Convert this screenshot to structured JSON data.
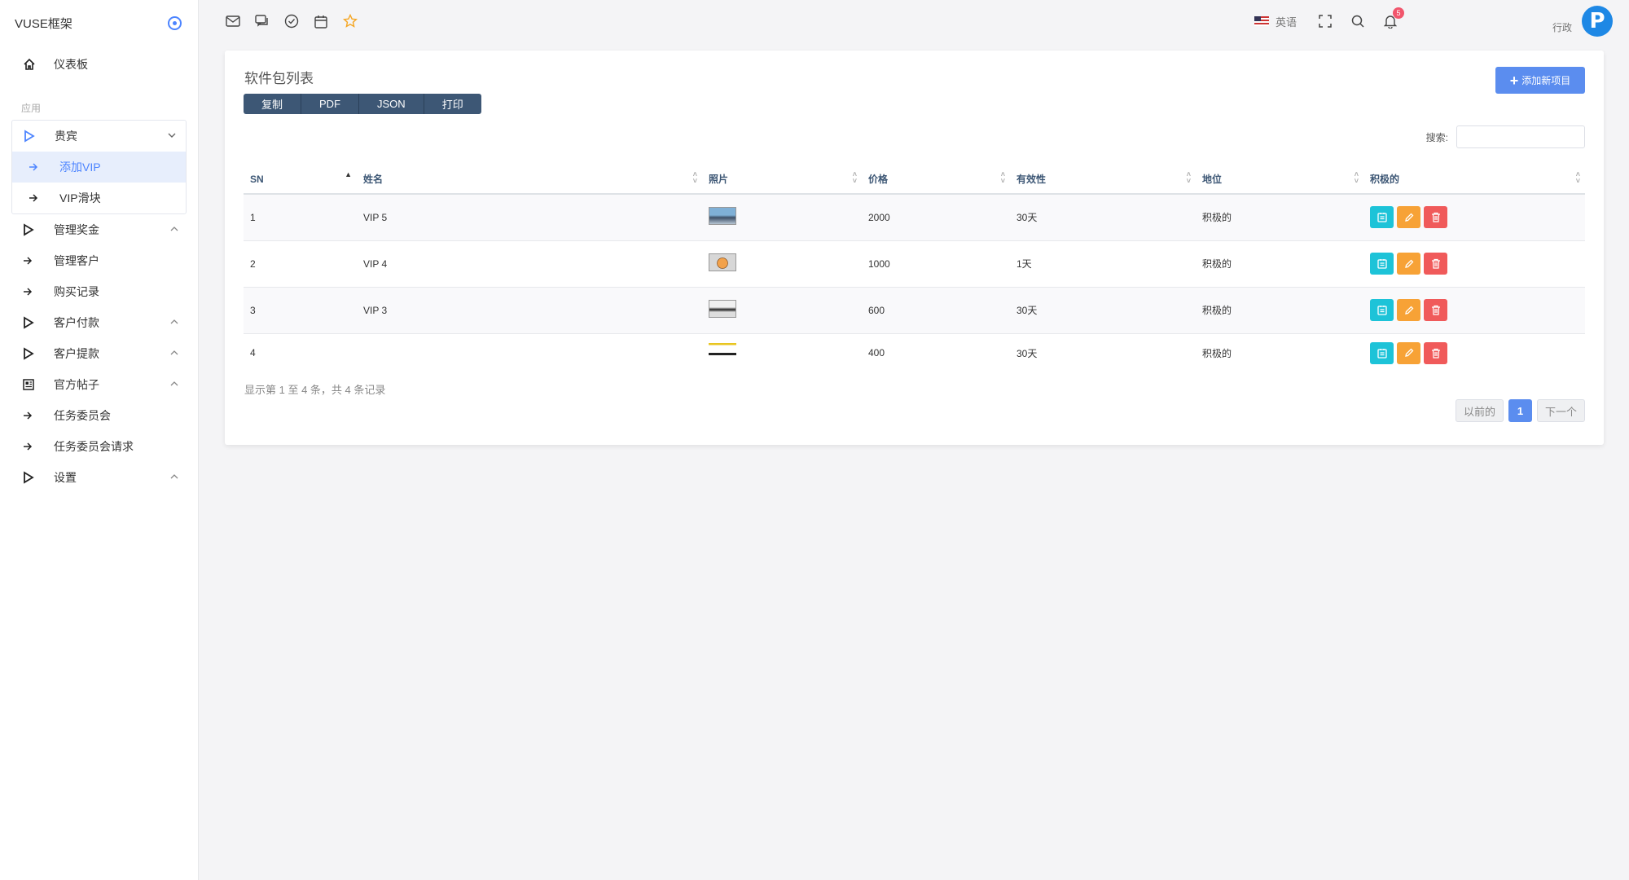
{
  "brand": "VUSE框架",
  "sidebar": {
    "dashboard": "仪表板",
    "section_label": "应用",
    "vip_group": {
      "label": "贵宾",
      "items": [
        {
          "label": "添加VIP",
          "active": true
        },
        {
          "label": "VIP滑块",
          "active": false
        }
      ]
    },
    "items": [
      {
        "label": "管理奖金",
        "icon": "play-outline-icon",
        "chevron": "˄"
      },
      {
        "label": "管理客户",
        "icon": "arrow-right-icon"
      },
      {
        "label": "购买记录",
        "icon": "arrow-right-icon"
      },
      {
        "label": "客户付款",
        "icon": "play-outline-icon",
        "chevron": "˄"
      },
      {
        "label": "客户提款",
        "icon": "play-outline-icon",
        "chevron": "˄"
      },
      {
        "label": "官方帖子",
        "icon": "newspaper-icon",
        "chevron": "˄"
      },
      {
        "label": "任务委员会",
        "icon": "arrow-right-icon"
      },
      {
        "label": "任务委员会请求",
        "icon": "arrow-right-icon"
      },
      {
        "label": "设置",
        "icon": "play-outline-icon",
        "chevron": "˄"
      }
    ]
  },
  "topbar": {
    "language": "英语",
    "notification_count": "5",
    "role": "行政",
    "avatar_letter": "P"
  },
  "card": {
    "title": "软件包列表",
    "export_buttons": [
      "复制",
      "PDF",
      "JSON",
      "打印"
    ],
    "add_button": "添加新项目",
    "search_label": "搜索:",
    "search_value": ""
  },
  "table": {
    "headers": [
      "SN",
      "姓名",
      "照片",
      "价格",
      "有效性",
      "地位",
      "积极的"
    ],
    "rows": [
      {
        "sn": "1",
        "name": "VIP 5",
        "price": "2000",
        "validity": "30天",
        "status": "积极的"
      },
      {
        "sn": "2",
        "name": "VIP 4",
        "price": "1000",
        "validity": "1天",
        "status": "积极的"
      },
      {
        "sn": "3",
        "name": "VIP 3",
        "price": "600",
        "validity": "30天",
        "status": "积极的"
      },
      {
        "sn": "4",
        "name": "",
        "price": "400",
        "validity": "30天",
        "status": "积极的"
      }
    ]
  },
  "footer": {
    "info": "显示第 1 至 4 条，共 4 条记录",
    "prev": "以前的",
    "page": "1",
    "next": "下一个"
  },
  "colors": {
    "primary": "#5b8def",
    "export_bg": "#3d5775",
    "view": "#1dc3d8",
    "edit": "#f7a236",
    "delete": "#f05a5a",
    "badge": "#f1556c"
  }
}
